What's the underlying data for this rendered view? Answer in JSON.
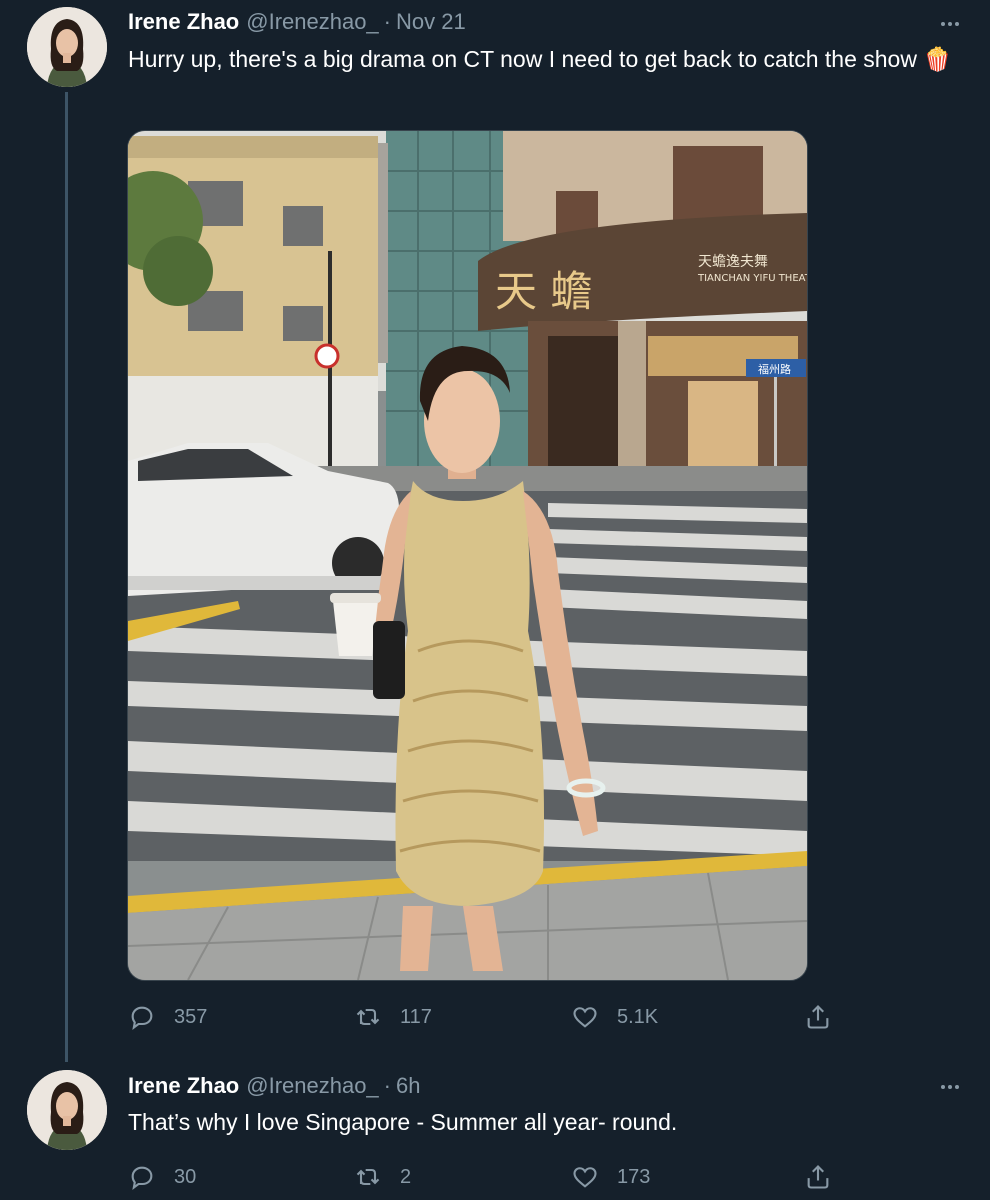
{
  "tweets": [
    {
      "author": {
        "display_name": "Irene Zhao",
        "handle": "@Irenezhao_"
      },
      "separator": "·",
      "timestamp": "Nov 21",
      "text": "Hurry up, there's a big drama on CT now I need to get back to catch the show 🍿",
      "media": {
        "sign_chinese": "天蟾逸夫舞",
        "sign_english": "TIANCHAN YIFU THEAT",
        "facade_chars": "天 蟾",
        "street_sign": "福州路"
      },
      "stats": {
        "replies": "357",
        "retweets": "117",
        "likes": "5.1K"
      }
    },
    {
      "author": {
        "display_name": "Irene Zhao",
        "handle": "@Irenezhao_"
      },
      "separator": "·",
      "timestamp": "6h",
      "text": "That’s why I love Singapore - Summer all year- round.",
      "stats": {
        "replies": "30",
        "retweets": "2",
        "likes": "173"
      }
    }
  ],
  "icons": [
    "reply-icon",
    "retweet-icon",
    "like-icon",
    "share-icon",
    "more-icon"
  ],
  "colors": {
    "background": "#15202b",
    "secondary_text": "#8899a6",
    "thread_line": "#3d5466"
  }
}
